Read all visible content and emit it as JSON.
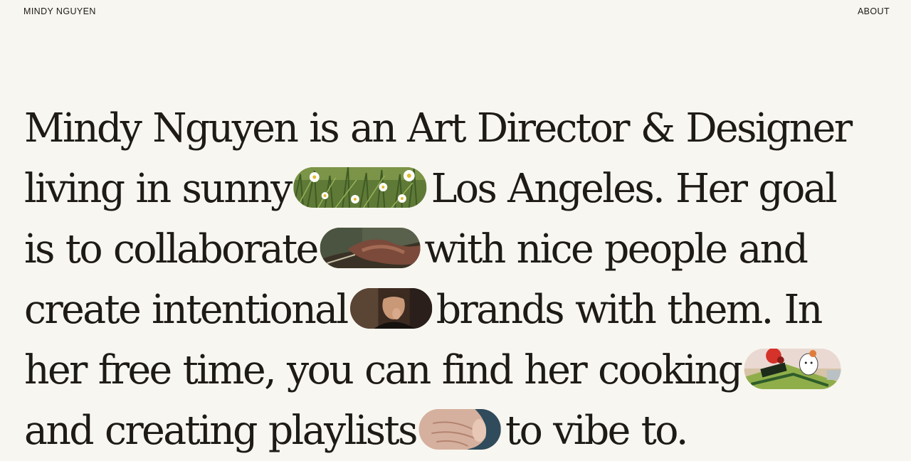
{
  "header": {
    "brand": "MINDY NGUYEN",
    "about": "ABOUT"
  },
  "bio": {
    "line1": "Mindy Nguyen is an Art Director & Designer",
    "line2a": "living in sunny",
    "line2b": "Los Angeles. Her goal",
    "line3a": "is to collaborate",
    "line3b": "with nice people and",
    "line4a": "create intentional",
    "line4b": "brands with them. In",
    "line5a": "her free time, you can find her cooking",
    "line6a": "and creating playlists",
    "line6b": "to vibe to."
  },
  "media": {
    "daisies": "daisy-field-thumbnail",
    "handshake": "handshake-thumbnail",
    "chef_kiss": "chefs-kiss-thumbnail",
    "cooking": "cartoon-cooking-thumbnail",
    "playlist": "hand-gesture-thumbnail"
  }
}
